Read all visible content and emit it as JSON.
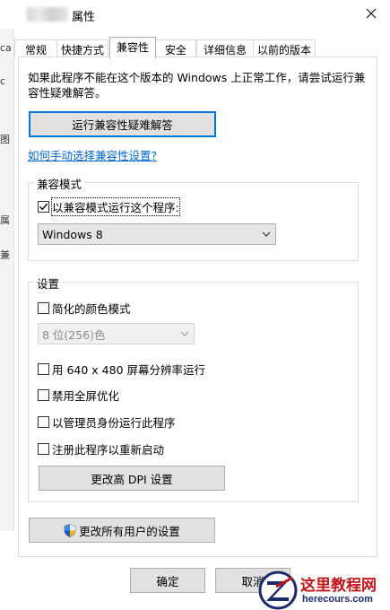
{
  "window": {
    "title": "属性"
  },
  "left_strip": {
    "chars": [
      "ca",
      "c",
      "图",
      "属",
      "兼"
    ]
  },
  "tabs": [
    {
      "label": "常规"
    },
    {
      "label": "快捷方式"
    },
    {
      "label": "兼容性"
    },
    {
      "label": "安全"
    },
    {
      "label": "详细信息"
    },
    {
      "label": "以前的版本"
    }
  ],
  "compat": {
    "description": "如果此程序不能在这个版本的 Windows 上正常工作，请尝试运行兼容性疑难解答。",
    "troubleshoot_button": "运行兼容性疑难解答",
    "manual_link": "如何手动选择兼容性设置?",
    "mode_group_title": "兼容模式",
    "mode_checkbox": "以兼容模式运行这个程序:",
    "mode_select": "Windows 8",
    "settings_group_title": "设置",
    "reduced_color": "简化的颜色模式",
    "color_select": "8 位(256)色",
    "res_640": "用 640 x 480 屏幕分辨率运行",
    "disable_fullscreen": "禁用全屏优化",
    "run_as_admin": "以管理员身份运行此程序",
    "register_restart": "注册此程序以重新启动",
    "dpi_button": "更改高 DPI 设置",
    "all_users_button": "更改所有用户的设置"
  },
  "footer": {
    "ok": "确定",
    "cancel": "取消"
  },
  "watermark": {
    "name": "这里教程网",
    "url": "herecours.com"
  }
}
